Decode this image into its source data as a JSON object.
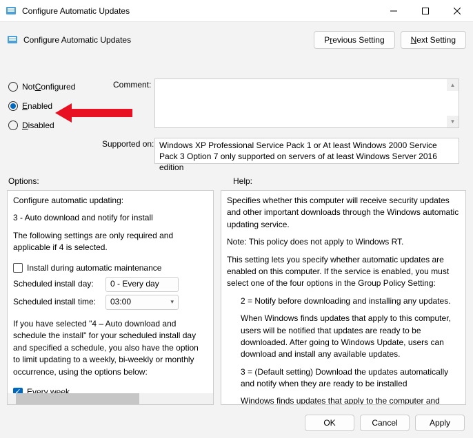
{
  "window": {
    "title": "Configure Automatic Updates"
  },
  "header": {
    "title": "Configure Automatic Updates",
    "prev_pre": "P",
    "prev_ul": "r",
    "prev_post": "evious Setting",
    "next_pre": "",
    "next_ul": "N",
    "next_post": "ext Setting"
  },
  "radios": {
    "nc_pre": "Not ",
    "nc_ul": "C",
    "nc_post": "onfigured",
    "en_ul": "E",
    "en_post": "nabled",
    "dis_ul": "D",
    "dis_post": "isabled"
  },
  "labels": {
    "comment": "Comment:",
    "supported": "Supported on:",
    "options": "Options:",
    "help": "Help:"
  },
  "supported_text": "Windows XP Professional Service Pack 1 or At least Windows 2000 Service Pack 3 Option 7 only supported on servers of at least Windows Server 2016 edition",
  "options": {
    "heading": "Configure automatic updating:",
    "mode": "3 - Auto download and notify for install",
    "note": "The following settings are only required and applicable if 4 is selected.",
    "install_maint": "Install during automatic maintenance",
    "sched_day_lbl": "Scheduled install day:",
    "sched_day_val": "0 - Every day",
    "sched_time_lbl": "Scheduled install time:",
    "sched_time_val": "03:00",
    "para": "If you have selected \"4 – Auto download and schedule the install\" for your scheduled install day and specified a schedule, you also have the option to limit updating to a weekly, bi-weekly or monthly occurrence, using the options below:",
    "every_week": "Every week"
  },
  "help": {
    "p1": "Specifies whether this computer will receive security updates and other important downloads through the Windows automatic updating service.",
    "p2": "Note: This policy does not apply to Windows RT.",
    "p3": "This setting lets you specify whether automatic updates are enabled on this computer. If the service is enabled, you must select one of the four options in the Group Policy Setting:",
    "opt2": "2 = Notify before downloading and installing any updates.",
    "opt2d": "When Windows finds updates that apply to this computer, users will be notified that updates are ready to be downloaded. After going to Windows Update, users can download and install any available updates.",
    "opt3": "3 = (Default setting) Download the updates automatically and notify when they are ready to be installed",
    "opt3d": "Windows finds updates that apply to the computer and"
  },
  "buttons": {
    "ok": "OK",
    "cancel": "Cancel",
    "apply": "Apply"
  }
}
